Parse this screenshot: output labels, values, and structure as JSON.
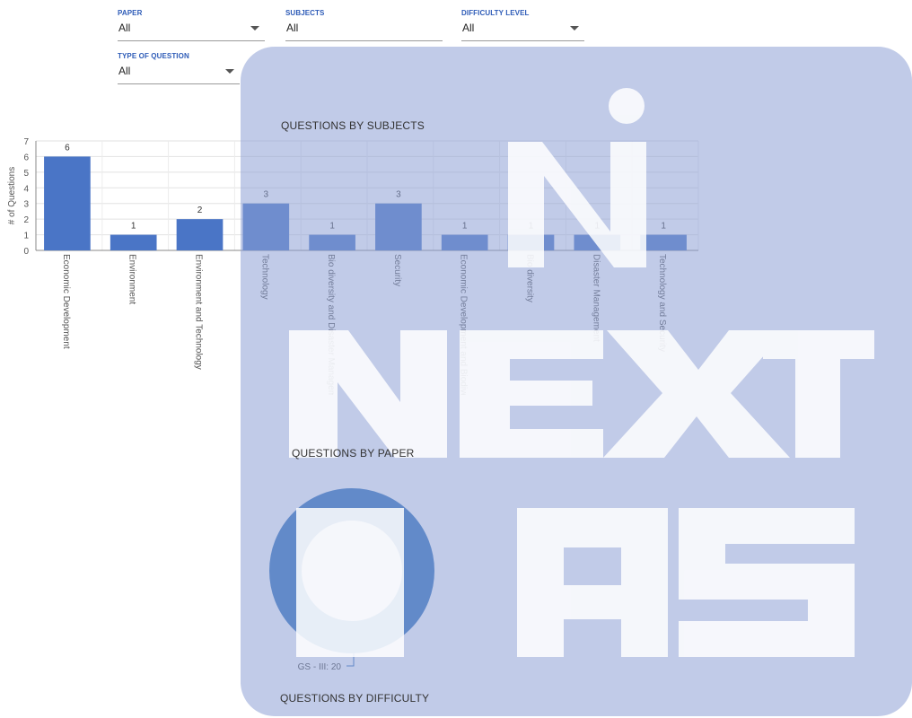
{
  "filters": [
    {
      "id": "paper",
      "label": "PAPER",
      "value": "All"
    },
    {
      "id": "subjects",
      "label": "SUBJECTS",
      "value": "All"
    },
    {
      "id": "difficulty",
      "label": "DIFFICULTY LEVEL",
      "value": "All"
    },
    {
      "id": "type",
      "label": "TYPE OF QUESTION",
      "value": "All"
    }
  ],
  "sections": {
    "subjects_title": "QUESTIONS BY SUBJECTS",
    "paper_title": "QUESTIONS BY PAPER",
    "difficulty_title": "QUESTIONS BY DIFFICULTY"
  },
  "watermark": {
    "brand": "NEXT IAS",
    "color": "#c5cfe9"
  },
  "chart_data": [
    {
      "type": "bar",
      "title": "QUESTIONS BY SUBJECTS",
      "ylabel": "# of Questions",
      "xlabel": "",
      "categories": [
        "Economic Development",
        "Environment",
        "Environment and Technology",
        "Technology",
        "Bio diversity and Disaster Management",
        "Security",
        "Economic Development and Biodiversity",
        "Bio diversity",
        "Disaster Management",
        "Technology and Security"
      ],
      "values": [
        6,
        1,
        2,
        3,
        1,
        3,
        1,
        1,
        1,
        1
      ],
      "ylim": [
        0,
        7
      ],
      "yticks": [
        0,
        1,
        2,
        3,
        4,
        5,
        6,
        7
      ],
      "grid": true,
      "color": "#4a75c6"
    },
    {
      "type": "pie",
      "title": "QUESTIONS BY PAPER",
      "donut": true,
      "slices": [
        {
          "label": "GS - III",
          "value": 20
        }
      ],
      "slice_labels": [
        "GS - III: 20"
      ],
      "color": "#2e6fba"
    }
  ]
}
